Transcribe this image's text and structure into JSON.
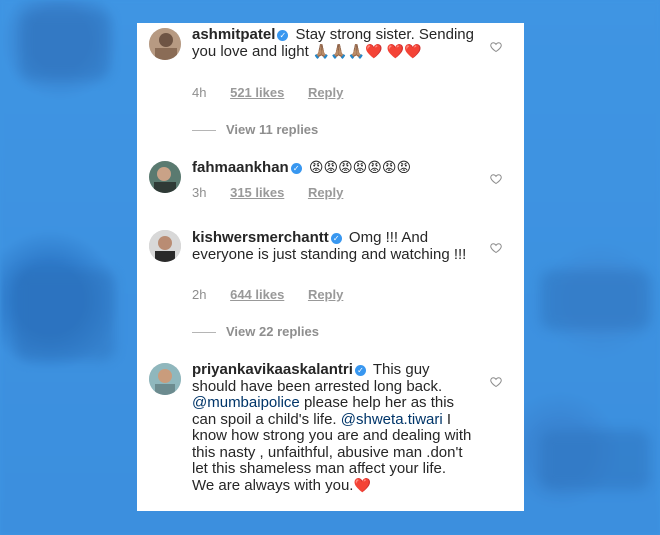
{
  "comments": [
    {
      "username": "ashmitpatel",
      "text": "Stay strong sister. Sending you love and light",
      "emoji": "🙏🏽🙏🏽🙏🏽❤️ ❤️❤️",
      "time": "4h",
      "likes": "521 likes",
      "reply": "Reply"
    },
    {
      "username": "fahmaankhan",
      "emoji": "😡😡😡😡😡😡😡",
      "time": "3h",
      "likes": "315 likes",
      "reply": "Reply"
    },
    {
      "username": "kishwersmerchantt",
      "text": "Omg !!! And everyone is just standing and watching !!!",
      "time": "2h",
      "likes": "644 likes",
      "reply": "Reply"
    },
    {
      "username": "priyankavikaaskalantri",
      "text_1": "This guy should have been arrested long back.",
      "mention_1": "@mumbaipolice",
      "text_2": "please help her as this can spoil a child's life.",
      "mention_2": "@shweta.tiwari",
      "text_3": "I know how strong you are and dealing with this nasty , unfaithful, abusive man .don't let this shameless man affect your life.",
      "text_4": "We are always with you.",
      "emoji": "❤️"
    }
  ],
  "view_replies": [
    "View 11 replies",
    "View 22 replies"
  ],
  "colors": {
    "verified": "#3897f0",
    "background": "#3f95e3",
    "meta": "#8e8e8e"
  }
}
